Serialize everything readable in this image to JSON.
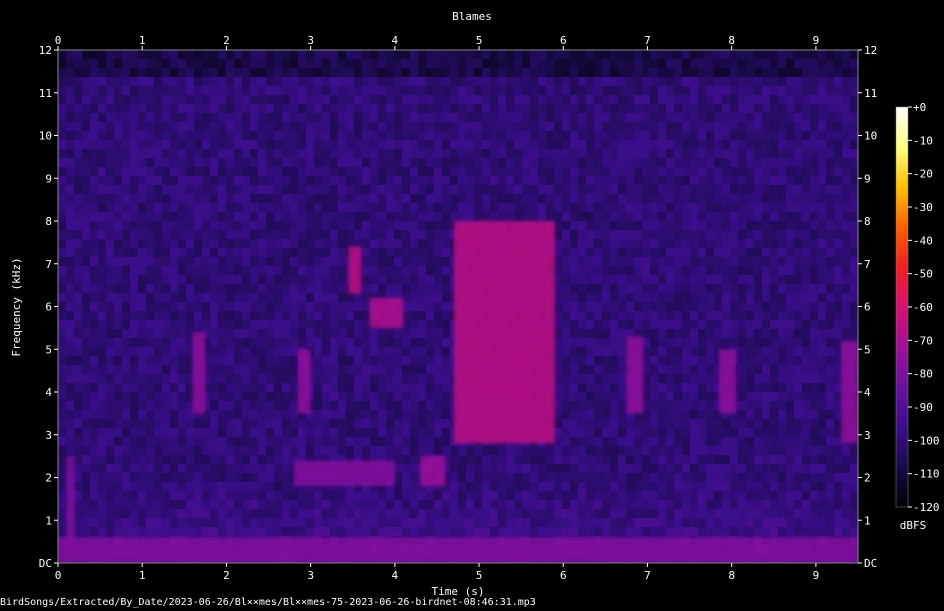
{
  "chart_data": {
    "type": "heatmap",
    "title": "Blames",
    "xlabel": "Time (s)",
    "ylabel": "Frequency (kHz)",
    "xlim": [
      0,
      9.5
    ],
    "ylim": [
      0,
      12
    ],
    "x_ticks": [
      "0",
      "1",
      "2",
      "3",
      "4",
      "5",
      "6",
      "7",
      "8",
      "9"
    ],
    "y_ticks": [
      "DC",
      "1",
      "2",
      "3",
      "4",
      "5",
      "6",
      "7",
      "8",
      "9",
      "10",
      "11",
      "12"
    ],
    "colorbar": {
      "label": "dBFS",
      "range": [
        -120,
        0
      ],
      "ticks": [
        "+0",
        "-10",
        "-20",
        "-30",
        "-40",
        "-50",
        "-60",
        "-70",
        "-80",
        "-90",
        "-100",
        "-110",
        "-120"
      ],
      "colors": [
        "#000000",
        "#1a0a4a",
        "#3a0e8a",
        "#6a10a0",
        "#a0109a",
        "#d81070",
        "#f02020",
        "#ff6000",
        "#ffc000",
        "#ffff80",
        "#ffffff"
      ]
    },
    "background_level_dbfs": -100,
    "energy_events": [
      {
        "t": [
          0.1,
          0.2
        ],
        "f_khz": [
          0.3,
          2.5
        ],
        "level_dbfs": -80
      },
      {
        "t": [
          1.6,
          1.75
        ],
        "f_khz": [
          3.5,
          5.4
        ],
        "level_dbfs": -75
      },
      {
        "t": [
          2.85,
          3.0
        ],
        "f_khz": [
          3.5,
          5.0
        ],
        "level_dbfs": -75
      },
      {
        "t": [
          2.8,
          4.0
        ],
        "f_khz": [
          1.8,
          2.4
        ],
        "level_dbfs": -78
      },
      {
        "t": [
          3.45,
          3.6
        ],
        "f_khz": [
          6.3,
          7.4
        ],
        "level_dbfs": -65
      },
      {
        "t": [
          3.7,
          4.1
        ],
        "f_khz": [
          5.5,
          6.2
        ],
        "level_dbfs": -68
      },
      {
        "t": [
          4.3,
          4.6
        ],
        "f_khz": [
          1.8,
          2.5
        ],
        "level_dbfs": -72
      },
      {
        "t": [
          4.7,
          5.9
        ],
        "f_khz": [
          2.8,
          8.0
        ],
        "level_dbfs": -65
      },
      {
        "t": [
          6.75,
          6.95
        ],
        "f_khz": [
          3.5,
          5.3
        ],
        "level_dbfs": -75
      },
      {
        "t": [
          7.85,
          8.05
        ],
        "f_khz": [
          3.5,
          5.0
        ],
        "level_dbfs": -75
      },
      {
        "t": [
          9.3,
          9.5
        ],
        "f_khz": [
          2.8,
          5.2
        ],
        "level_dbfs": -75
      },
      {
        "t": [
          0,
          9.5
        ],
        "f_khz": [
          0,
          0.6
        ],
        "level_dbfs": -78
      }
    ],
    "bottom_text": "BirdSongs/Extracted/By_Date/2023-06-26/Bl××mes/Bl××mes-75-2023-06-26-birdnet-08:46:31.mp3"
  }
}
